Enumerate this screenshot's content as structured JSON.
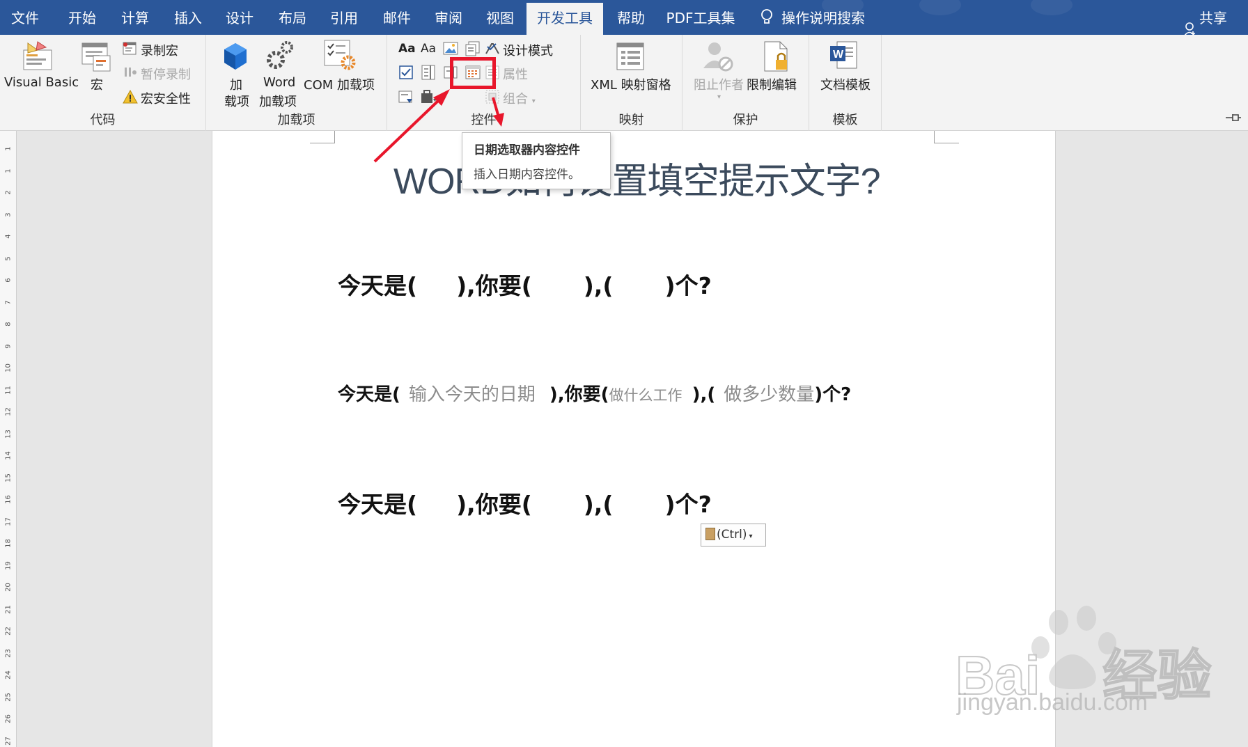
{
  "menu": {
    "tabs": [
      {
        "label": "文件"
      },
      {
        "label": "开始"
      },
      {
        "label": "计算"
      },
      {
        "label": "插入"
      },
      {
        "label": "设计"
      },
      {
        "label": "布局"
      },
      {
        "label": "引用"
      },
      {
        "label": "邮件"
      },
      {
        "label": "审阅"
      },
      {
        "label": "视图"
      },
      {
        "label": "开发工具"
      },
      {
        "label": "帮助"
      },
      {
        "label": "PDF工具集"
      },
      {
        "label": "操作说明搜索"
      }
    ],
    "active_tab": "开发工具",
    "share": "共享"
  },
  "ribbon": {
    "code": {
      "name": "代码",
      "visual_basic": "Visual Basic",
      "macros": "宏",
      "record_macro": "录制宏",
      "pause_recording": "暂停录制",
      "macro_security": "宏安全性"
    },
    "addins": {
      "name": "加载项",
      "addins_l1": "加",
      "addins_l2": "载项",
      "word_l1": "Word",
      "word_l2": "加载项",
      "com": "COM 加载项"
    },
    "controls": {
      "name": "控件",
      "aa1": "Aa",
      "aa2": "Aa",
      "design_mode": "设计模式",
      "properties": "属性",
      "group": "组合"
    },
    "mapping": {
      "name": "映射",
      "xml_pane": "XML 映射窗格"
    },
    "protect": {
      "name": "保护",
      "block_authors": "阻止作者",
      "restrict_editing": "限制编辑"
    },
    "templates": {
      "name": "模板",
      "document_template": "文档模板"
    }
  },
  "tooltip": {
    "title": "日期选取器内容控件",
    "description": "插入日期内容控件。"
  },
  "document": {
    "title": "WORD如何设置填空提示文字?",
    "line1": {
      "a": "今天是(",
      "b": "),你要(",
      "c": "),(",
      "d": ")个?"
    },
    "line2": {
      "a": "今天是(",
      "ph1": "输入今天的日期",
      "b": "),你要(",
      "ph2": "做什么工作",
      "c": "),(",
      "ph3": "做多少数量",
      "d": ")个?"
    },
    "line3": {
      "a": "今天是(",
      "b": "),你要(",
      "c": "),(",
      "d": ")个?"
    },
    "paste_options": "(Ctrl)"
  },
  "ruler": [
    "1",
    "1",
    "2",
    "3",
    "4",
    "5",
    "6",
    "7",
    "8",
    "9",
    "10",
    "11",
    "12",
    "13",
    "14",
    "15",
    "16",
    "17",
    "18",
    "19",
    "20",
    "21",
    "22",
    "23",
    "24",
    "25",
    "26",
    "27"
  ],
  "watermark": {
    "brand": "Baidu经验",
    "url": "jingyan.baidu.com"
  },
  "colors": {
    "menubar": "#2b579a",
    "ribbon": "#f3f3f3",
    "highlight": "#e8162b",
    "title": "#3b4a5c"
  }
}
